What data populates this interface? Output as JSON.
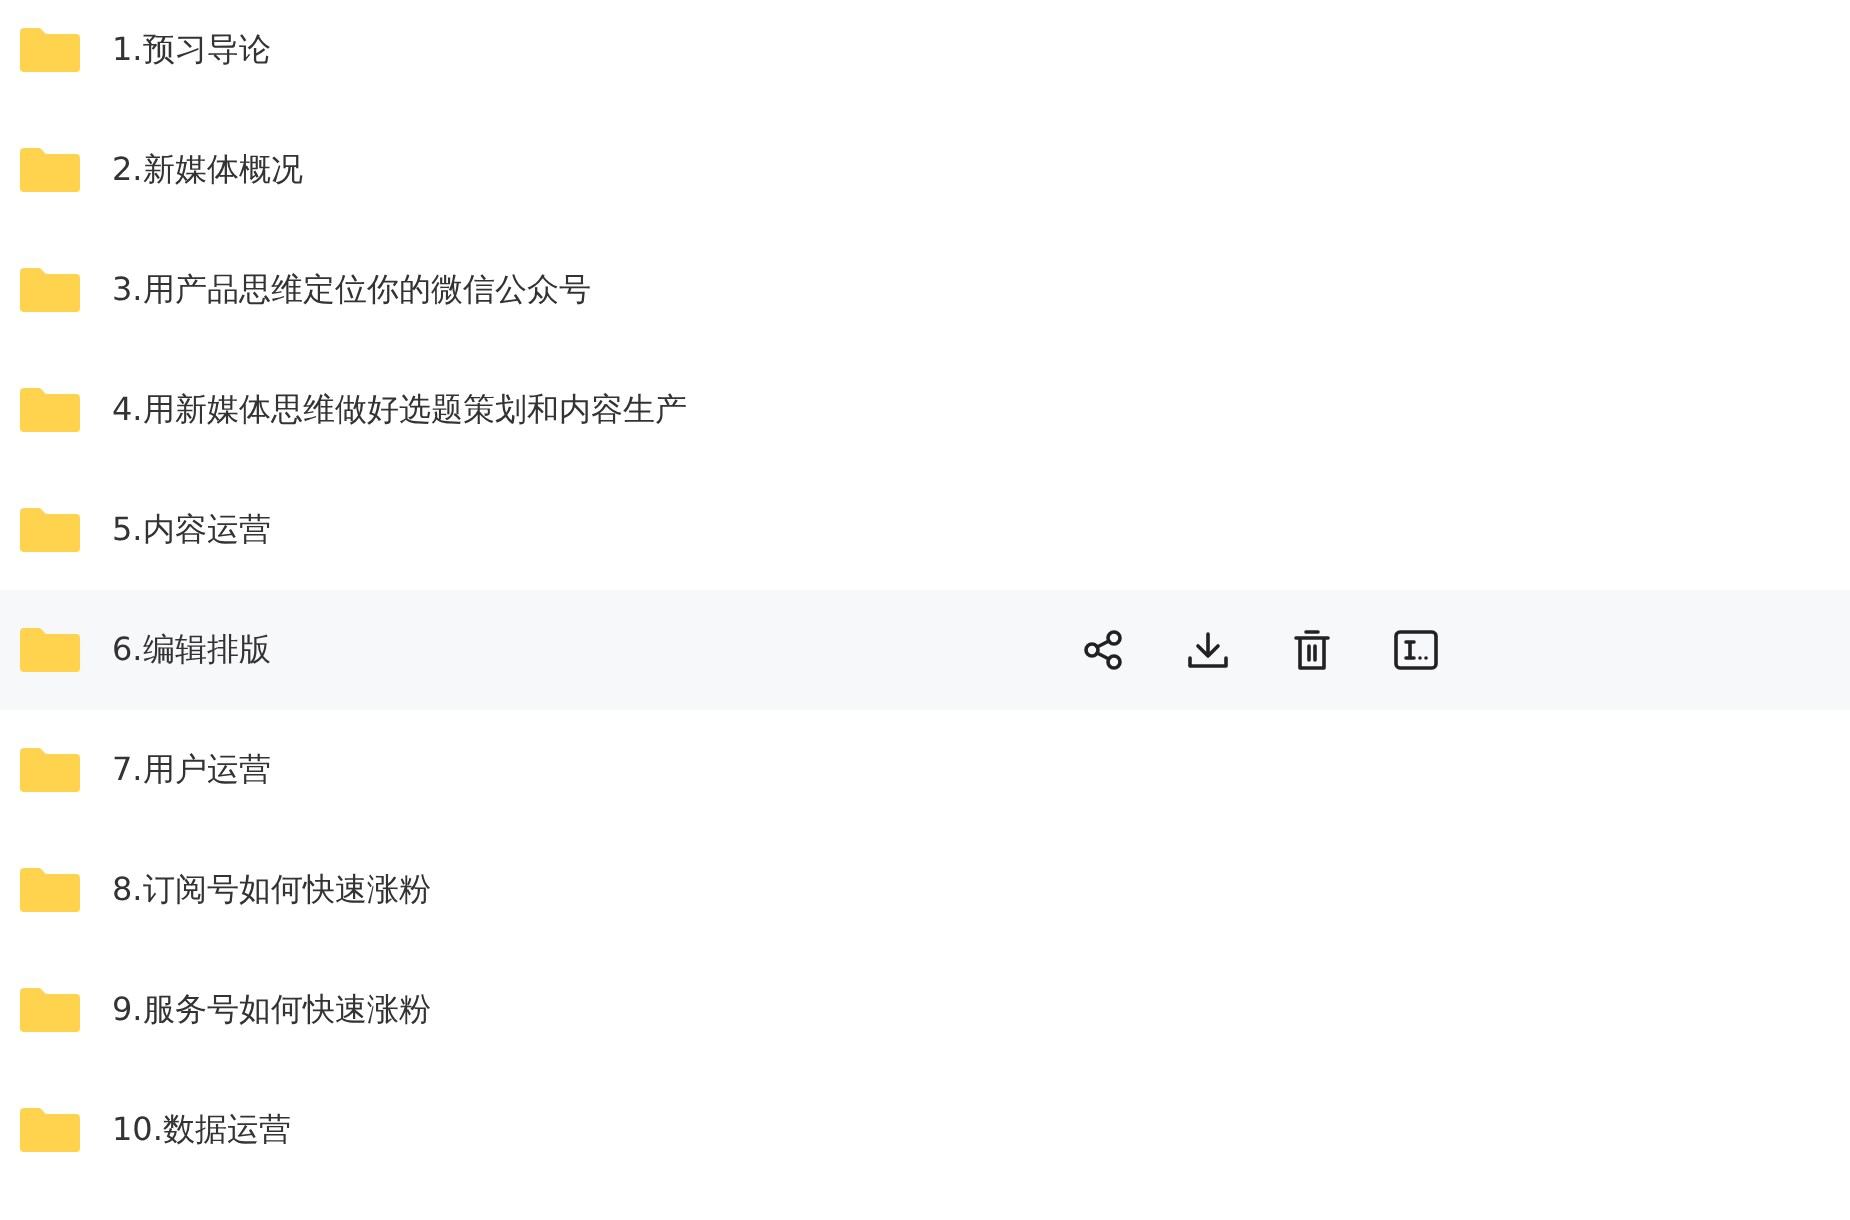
{
  "files": [
    {
      "name": "1.预习导论",
      "hovered": false
    },
    {
      "name": "2.新媒体概况",
      "hovered": false
    },
    {
      "name": "3.用产品思维定位你的微信公众号",
      "hovered": false
    },
    {
      "name": "4.用新媒体思维做好选题策划和内容生产",
      "hovered": false
    },
    {
      "name": "5.内容运营",
      "hovered": false
    },
    {
      "name": "6.编辑排版",
      "hovered": true
    },
    {
      "name": "7.用户运营",
      "hovered": false
    },
    {
      "name": "8.订阅号如何快速涨粉",
      "hovered": false
    },
    {
      "name": "9.服务号如何快速涨粉",
      "hovered": false
    },
    {
      "name": "10.数据运营",
      "hovered": false
    }
  ]
}
